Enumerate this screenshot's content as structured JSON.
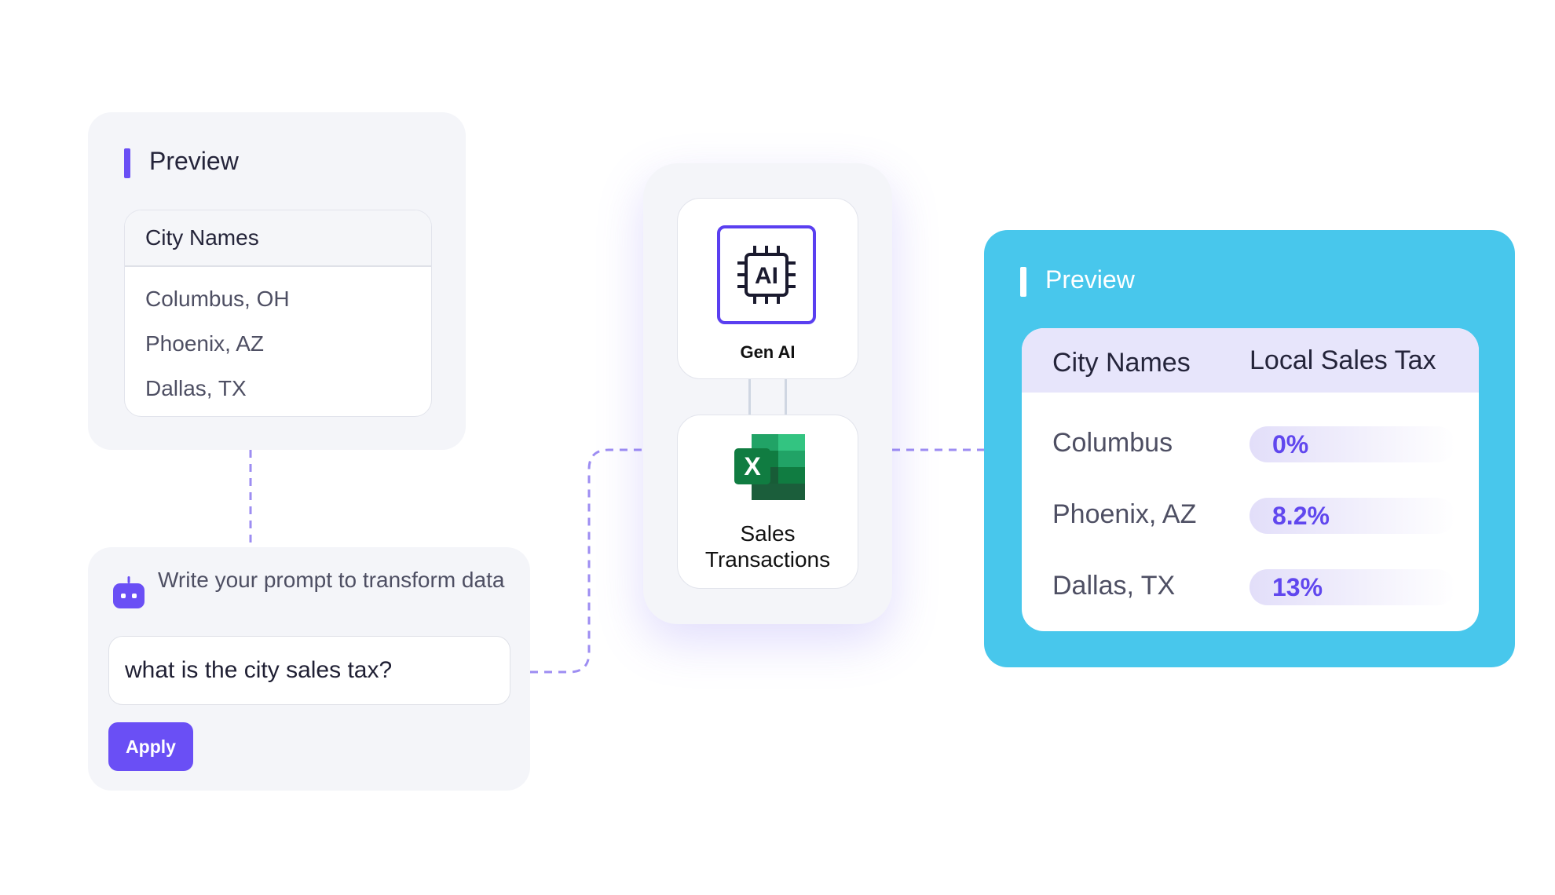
{
  "left_preview": {
    "title": "Preview",
    "column_header": "City Names",
    "rows": [
      "Columbus, OH",
      "Phoenix, AZ",
      "Dallas, TX"
    ]
  },
  "prompt": {
    "label": "Write your prompt to transform data",
    "input_value": "what is the city sales tax?",
    "apply_label": "Apply"
  },
  "pipeline": {
    "ai_chip_text": "AI",
    "ai_label": "Gen AI",
    "excel_letter": "X",
    "excel_label": "Sales Transactions"
  },
  "right_preview": {
    "title": "Preview",
    "headers": [
      "City Names",
      "Local Sales Tax"
    ],
    "rows": [
      {
        "city": "Columbus",
        "tax": "0%"
      },
      {
        "city": "Phoenix, AZ",
        "tax": "8.2%"
      },
      {
        "city": "Dallas, TX",
        "tax": "13%"
      }
    ]
  },
  "colors": {
    "accent_purple": "#6a4ff5",
    "panel_gray": "#f4f5f9",
    "output_blue": "#48c7ec",
    "excel_green": "#1d7044"
  }
}
